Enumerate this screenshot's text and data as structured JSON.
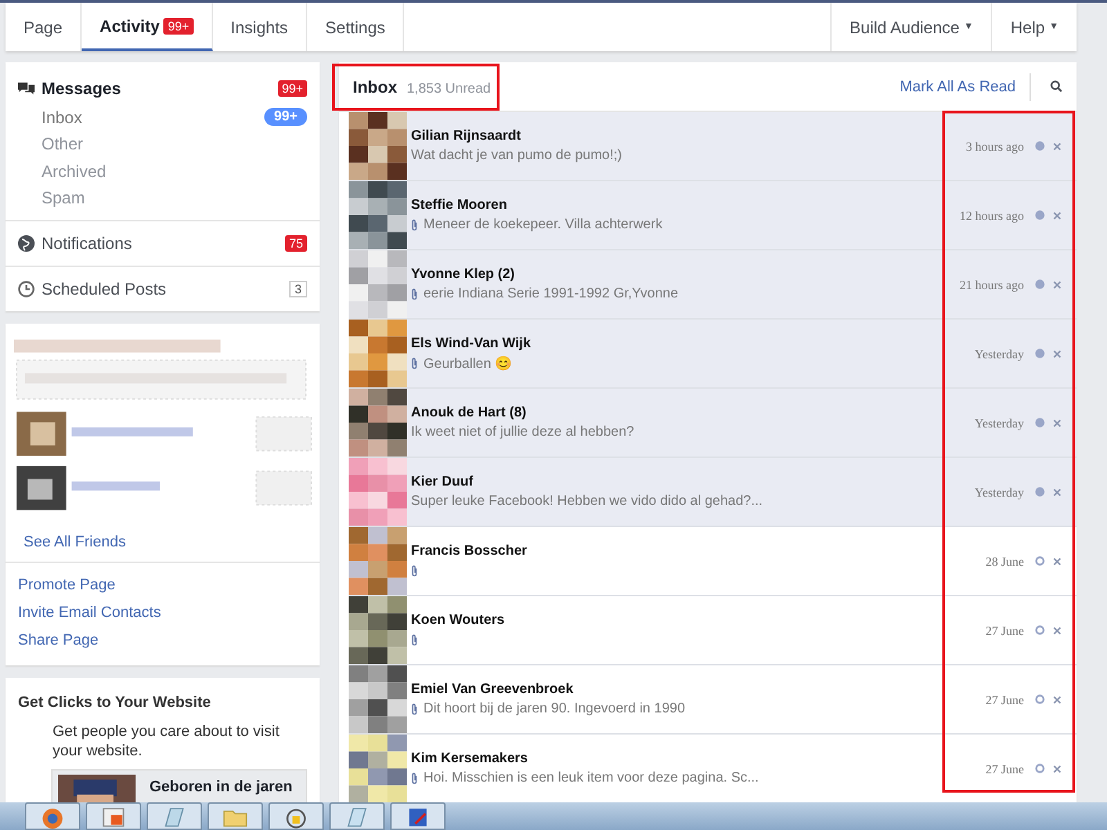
{
  "nav": {
    "tabs": [
      {
        "label": "Page",
        "selected": false
      },
      {
        "label": "Activity",
        "selected": true,
        "badge": "99+"
      },
      {
        "label": "Insights",
        "selected": false
      },
      {
        "label": "Settings",
        "selected": false
      }
    ],
    "menus": [
      {
        "label": "Build Audience",
        "caret": "▼"
      },
      {
        "label": "Help",
        "caret": "▼"
      }
    ]
  },
  "sidebar": {
    "messages": {
      "title": "Messages",
      "badge": "99+",
      "items": [
        {
          "label": "Inbox",
          "selected": true,
          "count": "99+"
        },
        {
          "label": "Other",
          "selected": false
        },
        {
          "label": "Archived",
          "selected": false
        },
        {
          "label": "Spam",
          "selected": false
        }
      ]
    },
    "sections": [
      {
        "kind": "notifications",
        "label": "Notifications",
        "count": "75"
      },
      {
        "kind": "scheduled",
        "label": "Scheduled Posts",
        "count": "3"
      }
    ],
    "friends": {
      "kind": "picture",
      "link": "See All Friends"
    },
    "links": [
      "Promote Page",
      "Invite Email Contacts",
      "Share Page"
    ],
    "ad": {
      "title": "Get Clicks to Your Website",
      "text": "Get people you care about to visit your website.",
      "preview": "Geboren in de jaren"
    }
  },
  "inbox": {
    "title": "Inbox",
    "title_highlighted": true,
    "times_highlighted": true,
    "unread": "1,853 Unread",
    "mark_all": "Mark All As Read",
    "rows": [
      {
        "name": "Gilian Rijnsaardt",
        "snippet": "Wat dacht je van pumo de pumo!;)",
        "attachment": false,
        "time": "3 hours ago",
        "unread": true
      },
      {
        "name": "Steffie Mooren",
        "snippet": "Meneer de koekepeer. Villa achterwerk",
        "attachment": true,
        "time": "12 hours ago",
        "unread": true
      },
      {
        "name": "Yvonne Klep (2)",
        "snippet": "eerie Indiana Serie 1991-1992 Gr,Yvonne",
        "attachment": true,
        "time": "21 hours ago",
        "unread": true
      },
      {
        "name": "Els Wind-Van Wijk",
        "snippet": "Geurballen 😊",
        "attachment": true,
        "time": "Yesterday",
        "unread": true
      },
      {
        "name": "Anouk de Hart (8)",
        "snippet": "Ik weet niet of jullie deze al hebben?",
        "attachment": false,
        "time": "Yesterday",
        "unread": true
      },
      {
        "name": "Kier Duuf",
        "snippet": "Super leuke Facebook! Hebben we vido dido al gehad?...",
        "attachment": false,
        "time": "Yesterday",
        "unread": true
      },
      {
        "name": "Francis Bosscher",
        "attachment": true,
        "time": "28 June",
        "unread": false
      },
      {
        "name": "Koen Wouters",
        "attachment": true,
        "time": "27 June",
        "unread": false
      },
      {
        "name": "Emiel Van Greevenbroek",
        "snippet": "Dit hoort bij de jaren 90. Ingevoerd in 1990",
        "attachment": true,
        "time": "27 June",
        "unread": false
      },
      {
        "name": "Kim Kersemakers",
        "snippet": "Hoi. Misschien is een leuk item voor deze pagina. Sc...",
        "attachment": true,
        "time": "27 June",
        "unread": false
      }
    ]
  }
}
